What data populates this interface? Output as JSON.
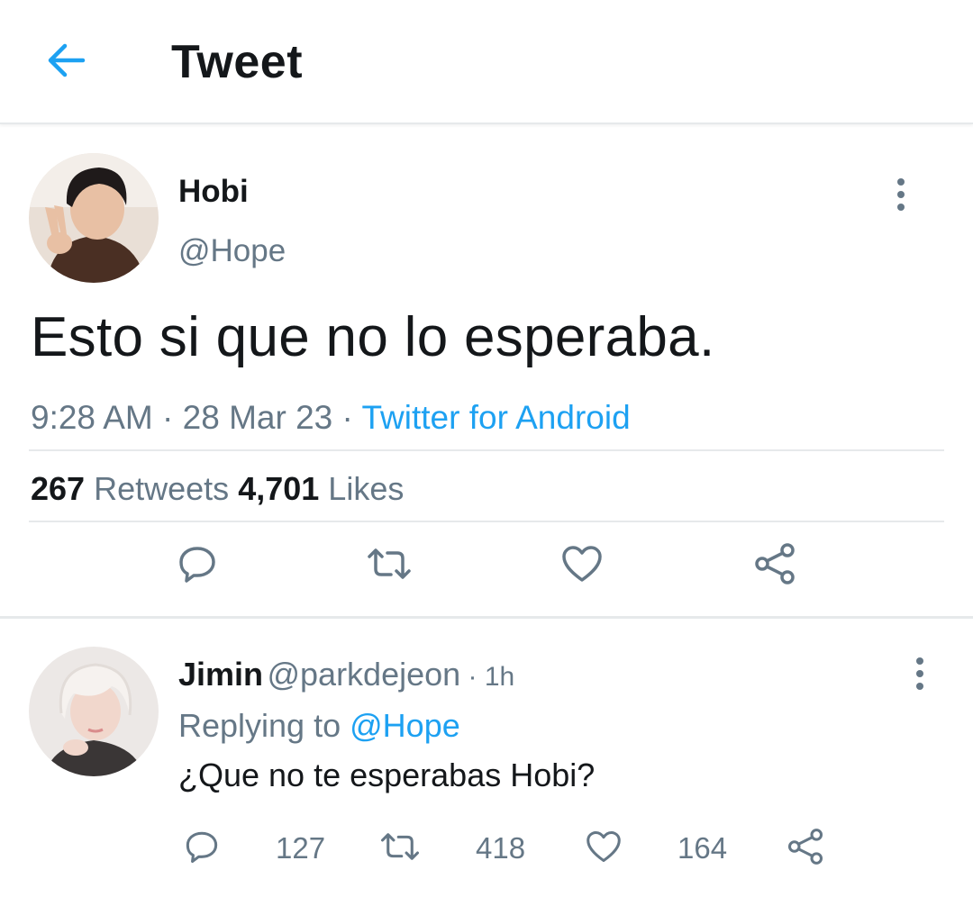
{
  "header": {
    "title": "Tweet",
    "back_icon": "arrow-left-icon",
    "accent_color": "#1da1f2"
  },
  "tweet": {
    "author": {
      "name": "Hobi",
      "handle": "@Hope",
      "avatar": "profile-photo"
    },
    "text": "Esto si que no lo esperaba.",
    "time": "9:28 AM",
    "date": "28 Mar 23",
    "separator": " · ",
    "source": "Twitter for Android",
    "stats": {
      "retweets_count": "267",
      "retweets_label": "Retweets",
      "likes_count": "4,701",
      "likes_label": "Likes"
    },
    "actions": [
      "reply-icon",
      "retweet-icon",
      "like-icon",
      "share-icon"
    ]
  },
  "reply": {
    "author": {
      "name": "Jimin",
      "handle": "@parkdejeon",
      "avatar": "profile-photo"
    },
    "time": "1h",
    "time_separator": " · ",
    "replying_label": "Replying to",
    "replying_to": "@Hope",
    "text": "¿Que no te esperabas Hobi?",
    "counts": {
      "replies": "127",
      "retweets": "418",
      "likes": "164"
    }
  },
  "colors": {
    "text_primary": "#14171a",
    "text_secondary": "#657786",
    "link": "#1da1f2",
    "divider": "#e6e9eb"
  }
}
